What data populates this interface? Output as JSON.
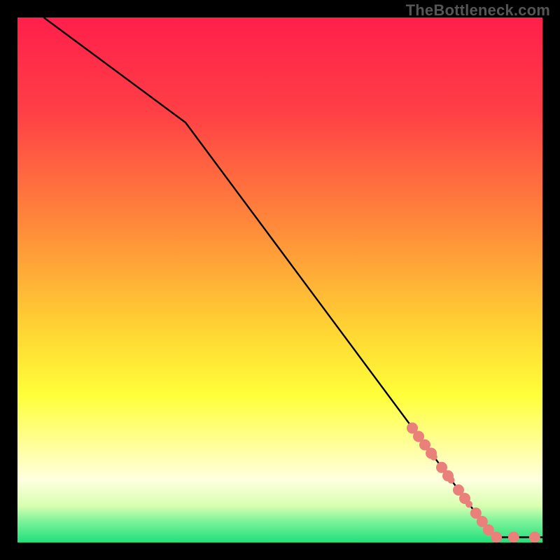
{
  "watermark": "TheBottleneck.com",
  "chart_data": {
    "type": "line",
    "title": "",
    "xlabel": "",
    "ylabel": "",
    "xlim": [
      0,
      100
    ],
    "ylim": [
      0,
      100
    ],
    "gradient_stops": [
      {
        "offset": 0,
        "color": "#ff1f4b"
      },
      {
        "offset": 18,
        "color": "#ff3f46"
      },
      {
        "offset": 40,
        "color": "#ff8b3a"
      },
      {
        "offset": 60,
        "color": "#ffd633"
      },
      {
        "offset": 72,
        "color": "#ffff3a"
      },
      {
        "offset": 82,
        "color": "#ffffa0"
      },
      {
        "offset": 88,
        "color": "#ffffe0"
      },
      {
        "offset": 93,
        "color": "#d8ffb0"
      },
      {
        "offset": 96,
        "color": "#7cf29a"
      },
      {
        "offset": 100,
        "color": "#1fe07a"
      }
    ],
    "series": [
      {
        "name": "curve",
        "stroke": "#000000",
        "x": [
          5,
          32,
          87,
          91,
          100
        ],
        "y": [
          100,
          80,
          6,
          1,
          1
        ]
      }
    ],
    "markers": {
      "name": "highlight-points",
      "fill": "#e98079",
      "radius_primary": 8,
      "radius_secondary": 5,
      "points": [
        {
          "x": 75.2,
          "y": 21.8,
          "r": "p"
        },
        {
          "x": 76.4,
          "y": 20.2,
          "r": "p"
        },
        {
          "x": 77.6,
          "y": 18.6,
          "r": "p"
        },
        {
          "x": 78.8,
          "y": 17.0,
          "r": "p"
        },
        {
          "x": 79.3,
          "y": 16.3,
          "r": "s"
        },
        {
          "x": 80.8,
          "y": 14.3,
          "r": "p"
        },
        {
          "x": 82.0,
          "y": 12.7,
          "r": "p"
        },
        {
          "x": 82.6,
          "y": 11.9,
          "r": "s"
        },
        {
          "x": 84.0,
          "y": 10.0,
          "r": "p"
        },
        {
          "x": 85.2,
          "y": 8.4,
          "r": "p"
        },
        {
          "x": 86.0,
          "y": 7.3,
          "r": "s"
        },
        {
          "x": 87.3,
          "y": 5.6,
          "r": "p"
        },
        {
          "x": 88.5,
          "y": 4.0,
          "r": "p"
        },
        {
          "x": 89.7,
          "y": 2.4,
          "r": "p"
        },
        {
          "x": 91.2,
          "y": 1.0,
          "r": "p"
        },
        {
          "x": 94.5,
          "y": 1.0,
          "r": "p"
        },
        {
          "x": 98.5,
          "y": 1.0,
          "r": "p"
        }
      ]
    }
  }
}
